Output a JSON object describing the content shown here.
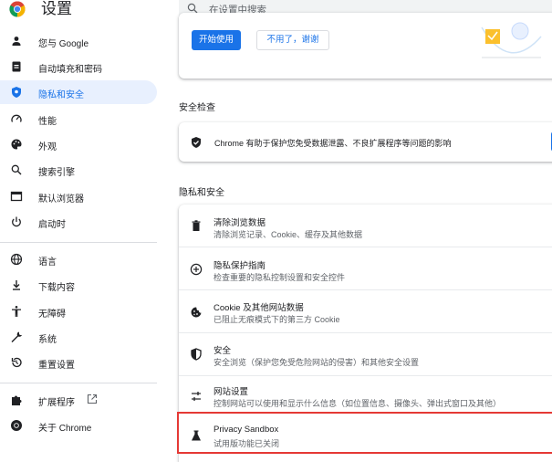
{
  "header": {
    "title": "设置",
    "search_placeholder": "在设置中搜索"
  },
  "sidebar": {
    "items": [
      {
        "label": "您与 Google",
        "icon": "person-icon"
      },
      {
        "label": "自动填充和密码",
        "icon": "clipboard-icon"
      },
      {
        "label": "隐私和安全",
        "icon": "shield-icon",
        "active": true
      },
      {
        "label": "性能",
        "icon": "speedometer-icon"
      },
      {
        "label": "外观",
        "icon": "palette-icon"
      },
      {
        "label": "搜索引擎",
        "icon": "search-icon"
      },
      {
        "label": "默认浏览器",
        "icon": "browser-icon"
      },
      {
        "label": "启动时",
        "icon": "power-icon"
      },
      {
        "label": "语言",
        "icon": "globe-icon"
      },
      {
        "label": "下载内容",
        "icon": "download-icon"
      },
      {
        "label": "无障碍",
        "icon": "accessibility-icon"
      },
      {
        "label": "系统",
        "icon": "wrench-icon"
      },
      {
        "label": "重置设置",
        "icon": "reset-icon"
      },
      {
        "label": "扩展程序",
        "icon": "puzzle-icon"
      },
      {
        "label": "关于 Chrome",
        "icon": "chrome-icon"
      }
    ]
  },
  "promo": {
    "start_label": "开始使用",
    "decline_label": "不用了，谢谢"
  },
  "safety_check": {
    "section_title": "安全检查",
    "text": "Chrome 有助于保护您免受数据泄露、不良扩展程序等问题的影响"
  },
  "privacy": {
    "section_title": "隐私和安全",
    "rows": [
      {
        "title": "清除浏览数据",
        "subtitle": "清除浏览记录、Cookie、缓存及其他数据",
        "icon": "trash-icon"
      },
      {
        "title": "隐私保护指南",
        "subtitle": "检查重要的隐私控制设置和安全控件",
        "icon": "compass-plus-icon"
      },
      {
        "title": "Cookie 及其他网站数据",
        "subtitle": "已阻止无痕模式下的第三方 Cookie",
        "icon": "cookie-icon"
      },
      {
        "title": "安全",
        "subtitle": "安全浏览（保护您免受危险网站的侵害）和其他安全设置",
        "icon": "shield-outline-icon"
      },
      {
        "title": "网站设置",
        "subtitle": "控制网站可以使用和显示什么信息（如位置信息、摄像头、弹出式窗口及其他）",
        "icon": "sliders-icon"
      },
      {
        "title": "Privacy Sandbox",
        "subtitle": "试用版功能已关闭",
        "icon": "flask-icon"
      }
    ]
  }
}
